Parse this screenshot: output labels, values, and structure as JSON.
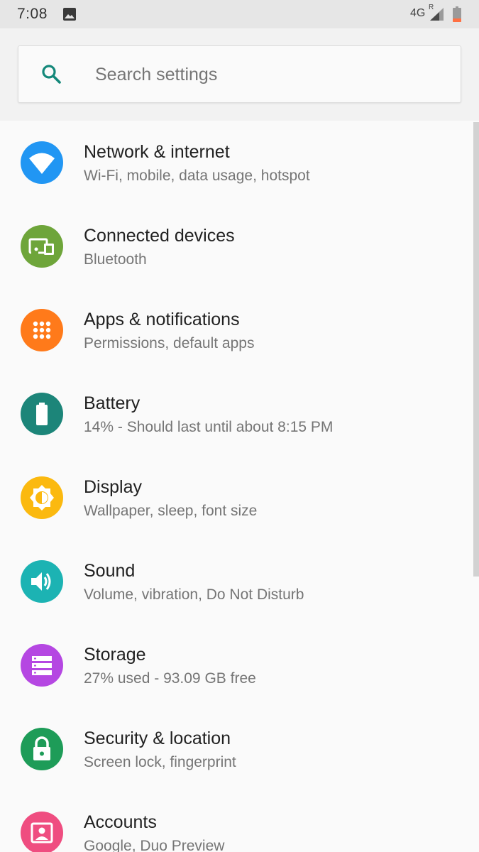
{
  "status_bar": {
    "time": "7:08",
    "network": "4G",
    "roaming": "R"
  },
  "search": {
    "placeholder": "Search settings"
  },
  "settings": [
    {
      "title": "Network & internet",
      "subtitle": "Wi-Fi, mobile, data usage, hotspot",
      "icon": "wifi-icon",
      "color": "#2196f3"
    },
    {
      "title": "Connected devices",
      "subtitle": "Bluetooth",
      "icon": "devices-icon",
      "color": "#6ea53a"
    },
    {
      "title": "Apps & notifications",
      "subtitle": "Permissions, default apps",
      "icon": "apps-grid-icon",
      "color": "#ff7a1a"
    },
    {
      "title": "Battery",
      "subtitle": "14% - Should last until about 8:15 PM",
      "icon": "battery-icon",
      "color": "#1c8579"
    },
    {
      "title": "Display",
      "subtitle": "Wallpaper, sleep, font size",
      "icon": "brightness-icon",
      "color": "#fbb90f"
    },
    {
      "title": "Sound",
      "subtitle": "Volume, vibration, Do Not Disturb",
      "icon": "volume-icon",
      "color": "#1cb3b3"
    },
    {
      "title": "Storage",
      "subtitle": "27% used - 93.09 GB free",
      "icon": "storage-icon",
      "color": "#b547e2"
    },
    {
      "title": "Security & location",
      "subtitle": "Screen lock, fingerprint",
      "icon": "lock-icon",
      "color": "#1e9c58"
    },
    {
      "title": "Accounts",
      "subtitle": "Google, Duo Preview",
      "icon": "account-icon",
      "color": "#ef4d80"
    }
  ]
}
